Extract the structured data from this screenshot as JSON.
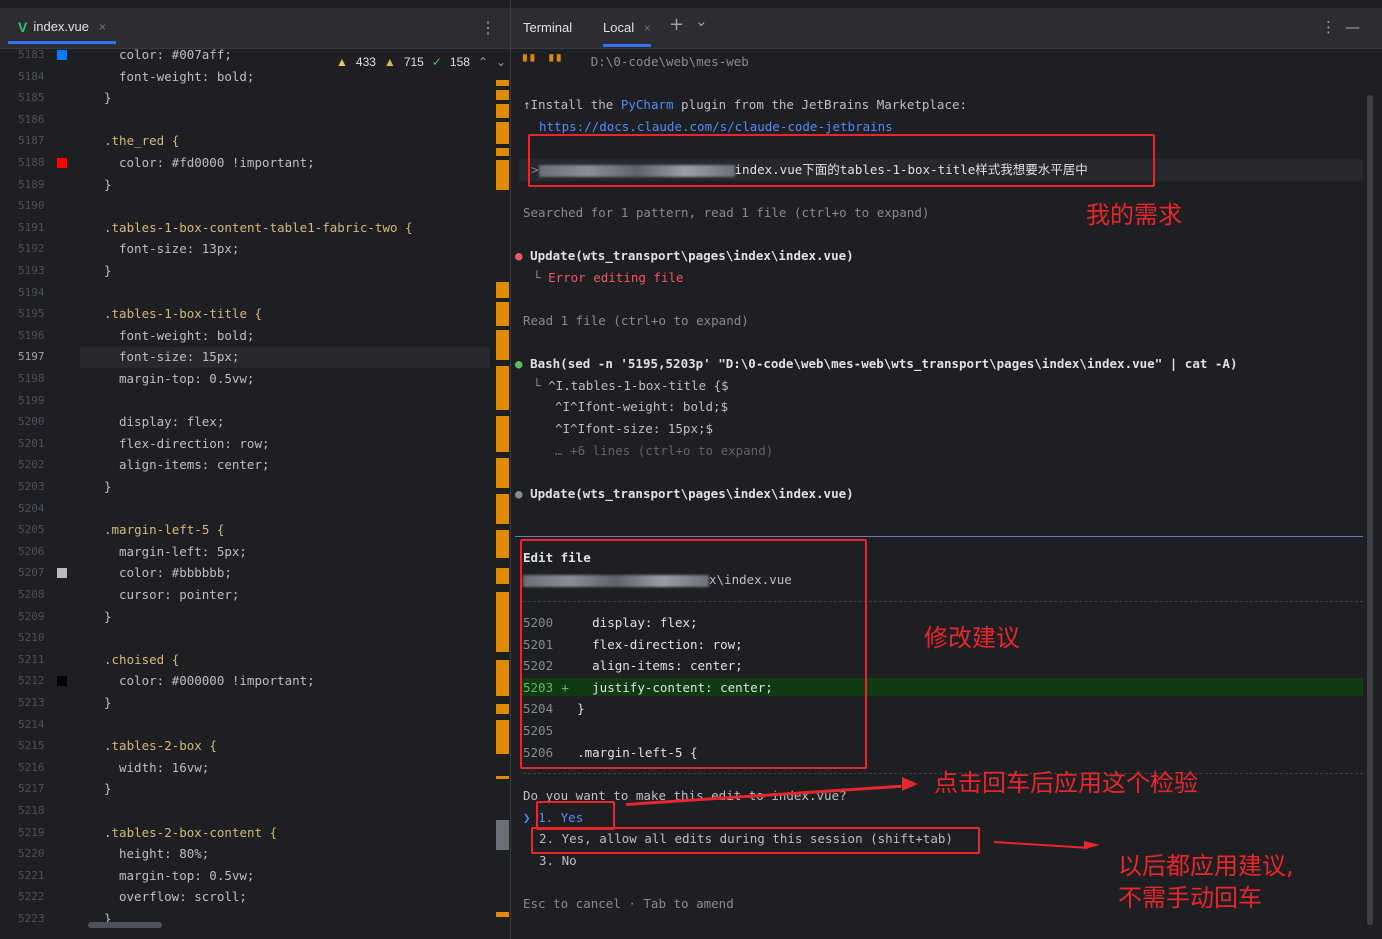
{
  "editor": {
    "tab_label": "index.vue",
    "tab_close": "×",
    "more_icon": "⋮",
    "inspections": {
      "errors": "433",
      "warnings": "715",
      "typos": "158"
    },
    "lines": [
      {
        "n": "5183",
        "text": "color: #007aff;"
      },
      {
        "n": "5184",
        "text": "font-weight: bold;"
      },
      {
        "n": "5185",
        "text": "}"
      },
      {
        "n": "5186",
        "text": ""
      },
      {
        "n": "5187",
        "text": ".the_red {"
      },
      {
        "n": "5188",
        "text": "color: #fd0000 !important;"
      },
      {
        "n": "5189",
        "text": "}"
      },
      {
        "n": "5190",
        "text": ""
      },
      {
        "n": "5191",
        "text": ".tables-1-box-content-table1-fabric-two {"
      },
      {
        "n": "5192",
        "text": "font-size: 13px;"
      },
      {
        "n": "5193",
        "text": "}"
      },
      {
        "n": "5194",
        "text": ""
      },
      {
        "n": "5195",
        "text": ".tables-1-box-title {"
      },
      {
        "n": "5196",
        "text": "font-weight: bold;"
      },
      {
        "n": "5197",
        "text": "font-size: 15px;"
      },
      {
        "n": "5198",
        "text": "margin-top: 0.5vw;"
      },
      {
        "n": "5199",
        "text": ""
      },
      {
        "n": "5200",
        "text": "display: flex;"
      },
      {
        "n": "5201",
        "text": "flex-direction: row;"
      },
      {
        "n": "5202",
        "text": "align-items: center;"
      },
      {
        "n": "5203",
        "text": "}"
      },
      {
        "n": "5204",
        "text": ""
      },
      {
        "n": "5205",
        "text": ".margin-left-5 {"
      },
      {
        "n": "5206",
        "text": "margin-left: 5px;"
      },
      {
        "n": "5207",
        "text": "color: #bbbbbb;"
      },
      {
        "n": "5208",
        "text": "cursor: pointer;"
      },
      {
        "n": "5209",
        "text": "}"
      },
      {
        "n": "5210",
        "text": ""
      },
      {
        "n": "5211",
        "text": ".choised {"
      },
      {
        "n": "5212",
        "text": "color: #000000 !important;"
      },
      {
        "n": "5213",
        "text": "}"
      },
      {
        "n": "5214",
        "text": ""
      },
      {
        "n": "5215",
        "text": ".tables-2-box {"
      },
      {
        "n": "5216",
        "text": "width: 16vw;"
      },
      {
        "n": "5217",
        "text": "}"
      },
      {
        "n": "5218",
        "text": ""
      },
      {
        "n": "5219",
        "text": ".tables-2-box-content {"
      },
      {
        "n": "5220",
        "text": "height: 80%;"
      },
      {
        "n": "5221",
        "text": "margin-top: 0.5vw;"
      },
      {
        "n": "5222",
        "text": "overflow: scroll;"
      },
      {
        "n": "5223",
        "text": "}"
      }
    ],
    "colors": {
      "blue": "#007aff",
      "red": "#fd0000",
      "light": "#bbbbbb",
      "black": "#000000"
    }
  },
  "terminal": {
    "title": "Terminal",
    "tab_local": "Local",
    "tab_close": "×",
    "add_icon": "+",
    "chevron_icon": "⌄",
    "more_icon": "⋮",
    "minimize_icon": "—",
    "cwd": "D:\\0-code\\web\\mes-web",
    "install_pre": "↑Install the ",
    "install_plugin": "PyCharm",
    "install_post": " plugin from the JetBrains Marketplace:",
    "install_link": "https://docs.claude.com/s/claude-code-jetbrains",
    "prompt_suffix": "index.vue下面的tables-1-box-title样式我想要水平居中",
    "searched": "Searched for 1 pattern, read 1 file (ctrl+o to expand)",
    "update1": "Update(wts_transport\\pages\\index\\index.vue)",
    "update1_result": "Error editing file",
    "read": "Read 1 file (ctrl+o to expand)",
    "bash": "Bash(sed -n '5195,5203p' \"D:\\0-code\\web\\mes-web\\wts_transport\\pages\\index\\index.vue\" | cat -A)",
    "bash_out": [
      "^I.tables-1-box-title {$",
      "^I^Ifont-weight: bold;$",
      "^I^Ifont-size: 15px;$",
      "… +6 lines (ctrl+o to expand)"
    ],
    "update2": "Update(wts_transport\\pages\\index\\index.vue)",
    "edit_title": "Edit file",
    "edit_path_suffix": "x\\index.vue",
    "diff": [
      {
        "n": "5200",
        "mark": "",
        "text": "  display: flex;"
      },
      {
        "n": "5201",
        "mark": "",
        "text": "  flex-direction: row;"
      },
      {
        "n": "5202",
        "mark": "",
        "text": "  align-items: center;"
      },
      {
        "n": "5203",
        "mark": "+",
        "text": "  justify-content: center;"
      },
      {
        "n": "5204",
        "mark": "",
        "text": "}"
      },
      {
        "n": "5205",
        "mark": "",
        "text": ""
      },
      {
        "n": "5206",
        "mark": "",
        "text": ".margin-left-5 {"
      }
    ],
    "question": "Do you want to make this edit to index.vue?",
    "options": [
      "1. Yes",
      "2. Yes, allow all edits during this session (shift+tab)",
      "3. No"
    ],
    "footer": "Esc to cancel · Tab to amend"
  },
  "annotations": {
    "my_need": "我的需求",
    "suggestion": "修改建议",
    "press_enter": "点击回车后应用这个检验",
    "auto_apply_1": "以后都应用建议,",
    "auto_apply_2": "不需手动回车"
  }
}
